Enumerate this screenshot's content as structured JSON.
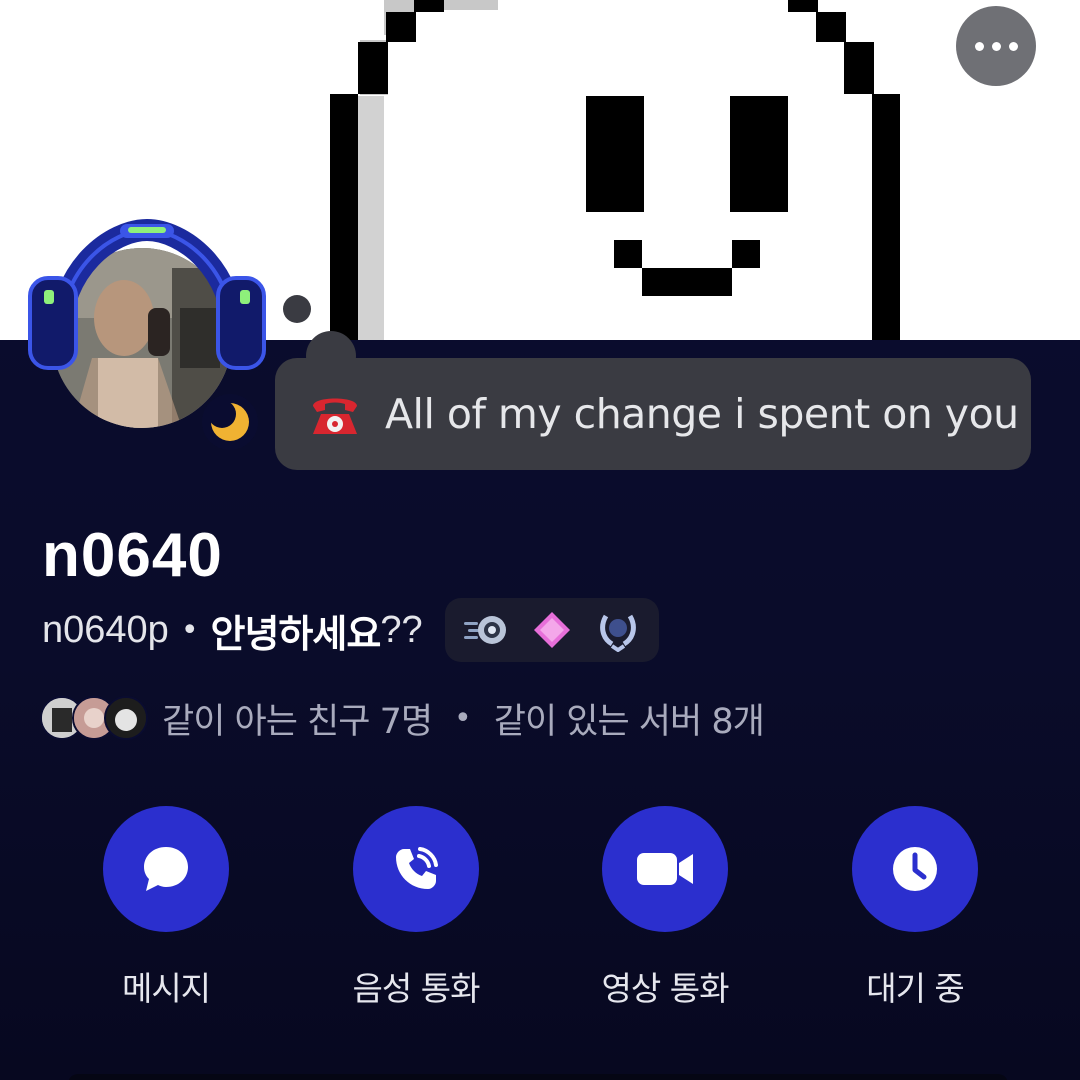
{
  "header": {
    "more_icon": "more-horizontal-icon"
  },
  "profile": {
    "display_name": "n0640",
    "username": "n0640p",
    "separator": "•",
    "pronouns": "안녕하세요",
    "pronouns_suffix": "??",
    "status_presence_icon": "moon-idle-icon",
    "avatar_decoration": "headphones-decoration"
  },
  "custom_status": {
    "emoji": "telephone-emoji",
    "text": "All of my change i spent on you"
  },
  "badges": [
    {
      "icon": "hypesquad-speed-badge"
    },
    {
      "icon": "nitro-gem-badge"
    },
    {
      "icon": "laurel-badge"
    }
  ],
  "mutuals": {
    "friends_text": "같이 아는 친구 7명",
    "separator": "•",
    "servers_text": "같이 있는 서버 8개"
  },
  "actions": [
    {
      "label": "메시지",
      "icon": "chat-bubble-icon"
    },
    {
      "label": "음성 통화",
      "icon": "phone-call-icon"
    },
    {
      "label": "영상 통화",
      "icon": "video-camera-icon"
    },
    {
      "label": "대기 중",
      "icon": "clock-icon"
    }
  ],
  "colors": {
    "background": "#0a0c30",
    "accent": "#2b2fce",
    "status_bubble": "#3a3b42",
    "idle_moon": "#f0b232"
  }
}
